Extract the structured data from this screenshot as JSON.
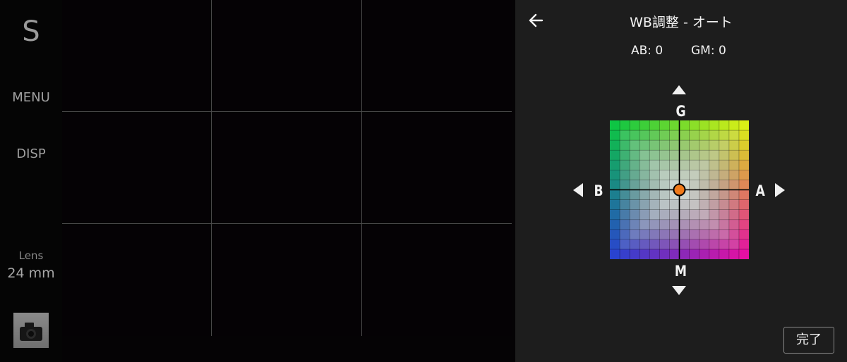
{
  "sidebar": {
    "mode": "S",
    "menu_label": "MENU",
    "disp_label": "DISP",
    "lens_label": "Lens",
    "lens_value": "24 mm"
  },
  "panel": {
    "title": "WB調整 - オート",
    "ab_readout": "AB: 0",
    "gm_readout": "GM: 0",
    "axis": {
      "g": "G",
      "m": "M",
      "b": "B",
      "a": "A"
    },
    "done_label": "完了",
    "ab_value": 0,
    "gm_value": 0,
    "cursor_color": "#ef7a1a",
    "icons": {
      "back": "back-arrow-icon",
      "up": "triangle-up-icon",
      "down": "triangle-down-icon",
      "left": "triangle-left-icon",
      "right": "triangle-right-icon"
    }
  }
}
